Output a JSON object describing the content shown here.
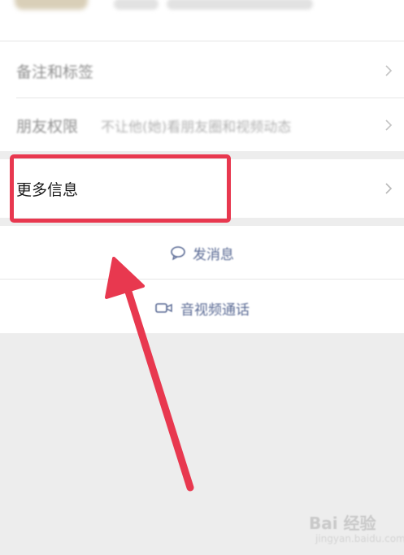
{
  "rows": {
    "remarks_tags": {
      "label": "备注和标签"
    },
    "friend_permission": {
      "label": "朋友权限",
      "value": "不让他(她)看朋友圈和视频动态"
    },
    "more_info": {
      "label": "更多信息"
    }
  },
  "actions": {
    "send_message": {
      "label": "发消息",
      "icon": "chat-bubble-icon"
    },
    "av_call": {
      "label": "音视频通话",
      "icon": "video-camera-icon"
    }
  },
  "annotation": {
    "highlight_color": "#e8384f",
    "arrow_color": "#e8384f"
  },
  "watermark": {
    "text": "Bai 经验",
    "sub": "jingyan.baidu.com"
  }
}
